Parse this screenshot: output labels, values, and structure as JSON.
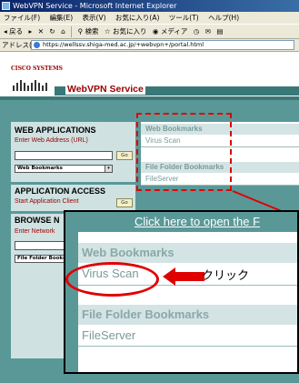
{
  "browser": {
    "title": "WebVPN Service - Microsoft Internet Explorer",
    "menu": [
      "ファイル(F)",
      "編集(E)",
      "表示(V)",
      "お気に入り(A)",
      "ツール(T)",
      "ヘルプ(H)"
    ],
    "toolbar": {
      "back_label": "戻る",
      "search_label": "検索",
      "favorites_label": "お気に入り",
      "media_label": "メディア"
    },
    "address_label": "アドレス(D)",
    "address_value": "https://wellssv.shiga-med.ac.jp/+webvpn+/portal.html"
  },
  "header": {
    "logo_text": "CISCO SYSTEMS",
    "app_title": "WebVPN Service"
  },
  "left": {
    "web_apps_title": "WEB APPLICATIONS",
    "web_address_label": "Enter Web Address (URL)",
    "go_label": "Go",
    "bookmarks_select": "Web Bookmarks",
    "app_access_title": "APPLICATION ACCESS",
    "start_app_label": "Start Application Client",
    "browse_title": "BROWSE N",
    "enter_network_label": "Enter Network",
    "folder_select": "File Folder Bookm"
  },
  "right": {
    "web_bookmarks_head": "Web Bookmarks",
    "virus_scan": "Virus Scan",
    "file_folder_head": "File Folder Bookmarks",
    "file_server": "FileServer"
  },
  "zoom": {
    "top_link": "Click here to open the F",
    "web_bookmarks_head": "Web Bookmarks",
    "virus_scan": "Virus Scan",
    "file_folder_head": "File Folder Bookmarks",
    "file_server": "FileServer",
    "click_label": "クリック"
  },
  "colors": {
    "accent_red": "#e00000",
    "teal": "#5a9898",
    "cisco_red": "#990000"
  }
}
